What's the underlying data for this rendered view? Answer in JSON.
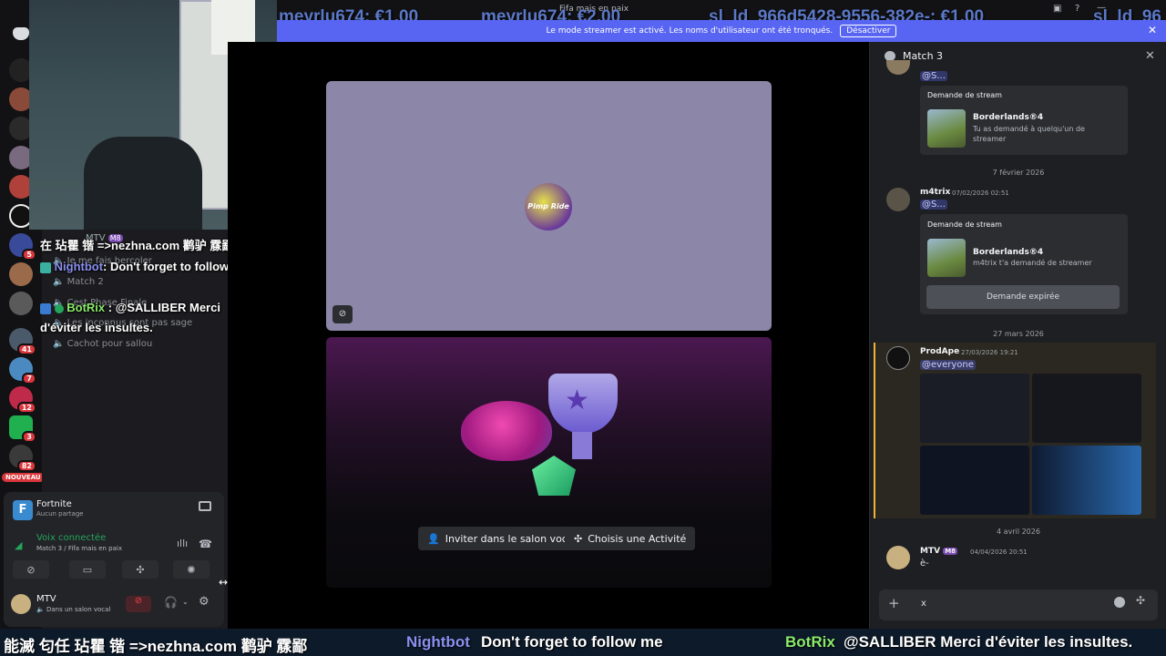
{
  "window": {
    "title": "Fifa mais en paix"
  },
  "top_names": [
    "meyrlu674: €1.00",
    "meyrlu674: €2.00",
    "sl_ld_966d5428-9556-382e-: €1.00",
    "sl_ld_96"
  ],
  "banner": {
    "text": "Le mode streamer est activé. Les noms d'utilisateur ont été tronqués.",
    "button": "Désactiver"
  },
  "rail_badges": [
    "5",
    "41",
    "7",
    "12",
    "3",
    "82"
  ],
  "rail_new_label": "NOUVEAU",
  "channels": {
    "items": [
      "MTV",
      "Je me fais bercoler",
      "Match 2",
      "Cest Phase Finale",
      "Les inconnus sont pas sage",
      "Cachot pour sallou"
    ],
    "mtv_badge": "M8"
  },
  "overlay": {
    "line1": "在 玷瞿 锴 =>nezhna.com 鹳驴 霡鄙",
    "nightbot_name": "Nightbot",
    "nightbot_msg": ": Don't forget to follow me",
    "botrix_name": "BotRix",
    "botrix_msg": ": @SALLIBER Merci",
    "botrix_msg2": "d'éviter les insultes."
  },
  "activity": {
    "game": "Fortnite",
    "status": "Aucun partage"
  },
  "voice": {
    "status": "Voix connectée",
    "channel": "Match 3 / Fifa mais en paix"
  },
  "user": {
    "name": "MTV",
    "status": "Dans un salon vocal"
  },
  "stage": {
    "invite_label": "Inviter dans le salon vocal",
    "activity_label": "Choisis une Activité",
    "logo_text": "Pimp Ride"
  },
  "right_panel": {
    "title": "Match 3",
    "msgs": [
      {
        "mention": "@S...",
        "embed_title": "Demande de stream",
        "game": "Borderlands®4",
        "desc": "Tu as demandé à quelqu'un de streamer"
      },
      {
        "date": "7 février 2026",
        "author": "m4trix",
        "time": "07/02/2026 02:51",
        "mention": "@S...",
        "embed_title": "Demande de stream",
        "game": "Borderlands®4",
        "desc": "m4trix t'a demandé de streamer",
        "button": "Demande expirée"
      },
      {
        "date": "27 mars 2026",
        "author": "ProdApe",
        "time": "27/03/2026 19:21",
        "mention": "@everyone"
      },
      {
        "date": "4 avril 2026",
        "author": "MTV",
        "badge": "M8",
        "time": "04/04/2026 20:51",
        "text": "è-"
      }
    ],
    "input_value": "x"
  },
  "ticker": {
    "segment1": "能滅 匂任 玷瞿 锴 =>nezhna.com 鹳驴 霡鄙",
    "nightbot": "Nightbot",
    "nightbot_msg": "Don't forget to follow me",
    "botrix": "BotRix",
    "botrix_msg": "@SALLIBER Merci d'éviter les insultes."
  }
}
